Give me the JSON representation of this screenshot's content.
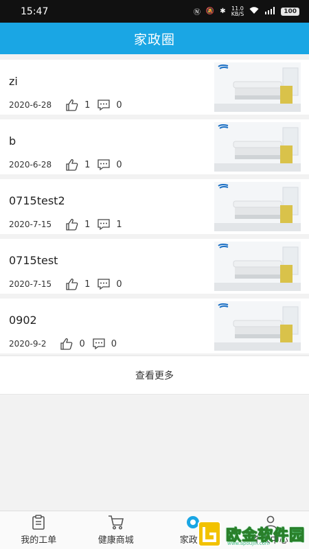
{
  "status_bar": {
    "time": "15:47",
    "net_speed_value": "11.0",
    "net_speed_unit": "KB/S",
    "battery": "100"
  },
  "header": {
    "title": "家政圈"
  },
  "posts": [
    {
      "title": "zi",
      "date": "2020-6-28",
      "likes": "1",
      "comments": "0"
    },
    {
      "title": "b",
      "date": "2020-6-28",
      "likes": "1",
      "comments": "0"
    },
    {
      "title": "0715test2",
      "date": "2020-7-15",
      "likes": "1",
      "comments": "1"
    },
    {
      "title": "0715test",
      "date": "2020-7-15",
      "likes": "1",
      "comments": "0"
    },
    {
      "title": "0902",
      "date": "2020-9-2",
      "likes": "0",
      "comments": "0"
    }
  ],
  "load_more": "查看更多",
  "tabbar": {
    "tabs": [
      {
        "label": "我的工单",
        "icon": "clipboard-icon"
      },
      {
        "label": "健康商城",
        "icon": "cart-icon"
      },
      {
        "label": "家政圈",
        "icon": "circle-icon"
      },
      {
        "label": "个人中心",
        "icon": "person-icon"
      }
    ]
  },
  "watermark": {
    "text": "欧金软件园",
    "sub": "www.apoujin.com"
  },
  "colors": {
    "header_bg": "#1aa6e4",
    "status_bg": "#111111",
    "page_bg": "#f2f2f2"
  }
}
